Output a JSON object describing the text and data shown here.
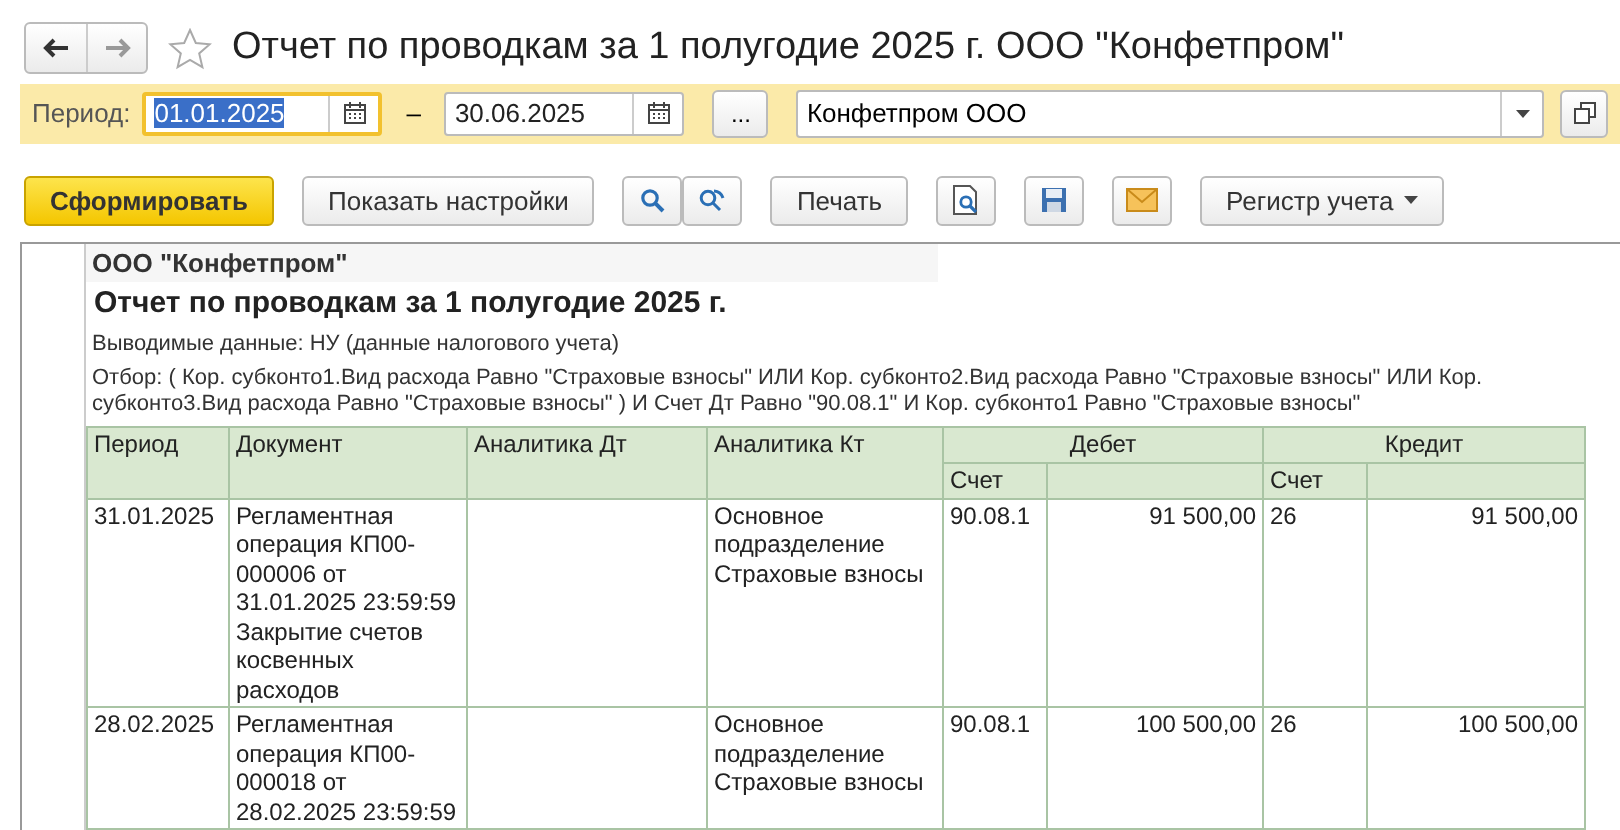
{
  "window": {
    "title": "Отчет по проводкам за 1 полугодие 2025 г. ООО \"Конфетпром\""
  },
  "period": {
    "label": "Период:",
    "from": {
      "value": "01.01.2025",
      "selected": true
    },
    "dash": "–",
    "to": {
      "value": "30.06.2025",
      "selected": false
    },
    "more": "...",
    "organization": "Конфетпром ООО"
  },
  "toolbar": [
    {
      "kind": "primary",
      "label": "Сформировать"
    },
    {
      "kind": "text",
      "label": "Показать настройки"
    },
    {
      "kind": "icon"
    },
    {
      "kind": "icon"
    },
    {
      "kind": "text",
      "label": "Печать"
    },
    {
      "kind": "icon"
    },
    {
      "kind": "icon"
    },
    {
      "kind": "icon"
    },
    {
      "kind": "menu",
      "label": "Регистр учета"
    }
  ],
  "report": {
    "organization": "ООО \"Конфетпром\"",
    "title": "Отчет по проводкам за 1 полугодие 2025 г.",
    "output": "Выводимые данные: НУ (данные налогового учета)",
    "filter": "Отбор: ( Кор. субконто1.Вид расхода Равно \"Страховые взносы\" ИЛИ Кор. субконто2.Вид расхода Равно \"Страховые взносы\" ИЛИ Кор. субконто3.Вид расхода Равно \"Страховые взносы\" ) И Счет Дт Равно \"90.08.1\" И Кор. субконто1 Равно \"Страховые взносы\"",
    "columns": [
      "Период",
      "Документ",
      "Аналитика Дт",
      "Аналитика Кт"
    ],
    "groups": [
      {
        "label": "Дебет",
        "sub": "Счет"
      },
      {
        "label": "Кредит",
        "sub": "Счет"
      }
    ],
    "rows": [
      {
        "period": "31.01.2025",
        "document": "Регламентная операция КП00-000006 от 31.01.2025 23:59:59 Закрытие счетов косвенных расходов",
        "analytics_kt": "Основное подразделение Страховые взносы",
        "debit_account": "90.08.1",
        "debit_amount": "91 500,00",
        "credit_account": "26",
        "credit_amount": "91 500,00"
      },
      {
        "period": "28.02.2025",
        "document": "Регламентная операция КП00-000018 от 28.02.2025 23:59:59",
        "analytics_kt": "Основное подразделение Страховые взносы",
        "debit_account": "90.08.1",
        "debit_amount": "100 500,00",
        "credit_account": "26",
        "credit_amount": "100 500,00"
      }
    ]
  }
}
